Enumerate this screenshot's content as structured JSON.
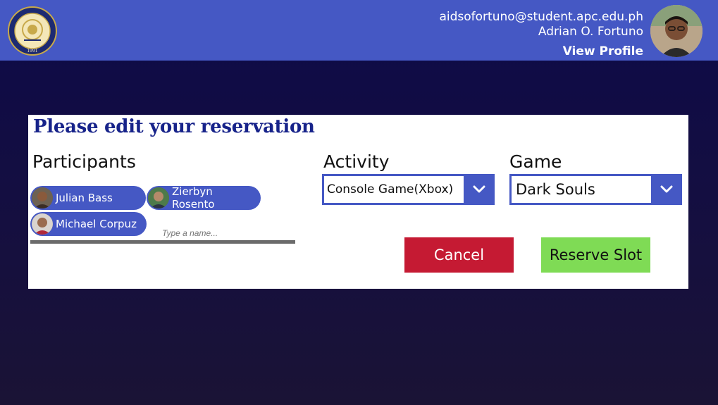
{
  "header": {
    "logo_text": "ASIA PACIFIC COLLEGE 1991",
    "user_email": "aidsofortuno@student.apc.edu.ph",
    "user_name": "Adrian O. Fortuno",
    "view_profile_label": "View Profile"
  },
  "form": {
    "title": "Please edit your reservation",
    "participants_label": "Participants",
    "participants": [
      {
        "name": "Julian Bass"
      },
      {
        "name": "Zierbyn Rosento"
      },
      {
        "name": "Michael Corpuz"
      }
    ],
    "name_input_placeholder": "Type a name...",
    "activity_label": "Activity",
    "activity_value": "Console Game(Xbox)",
    "game_label": "Game",
    "game_value": "Dark Souls",
    "cancel_label": "Cancel",
    "reserve_label": "Reserve Slot"
  },
  "colors": {
    "header_bg": "#4558c4",
    "title": "#17238a",
    "cancel": "#c51a33",
    "reserve": "#7fdb55"
  },
  "icons": [
    "college-seal-logo",
    "chevron-down-icon",
    "avatar"
  ]
}
